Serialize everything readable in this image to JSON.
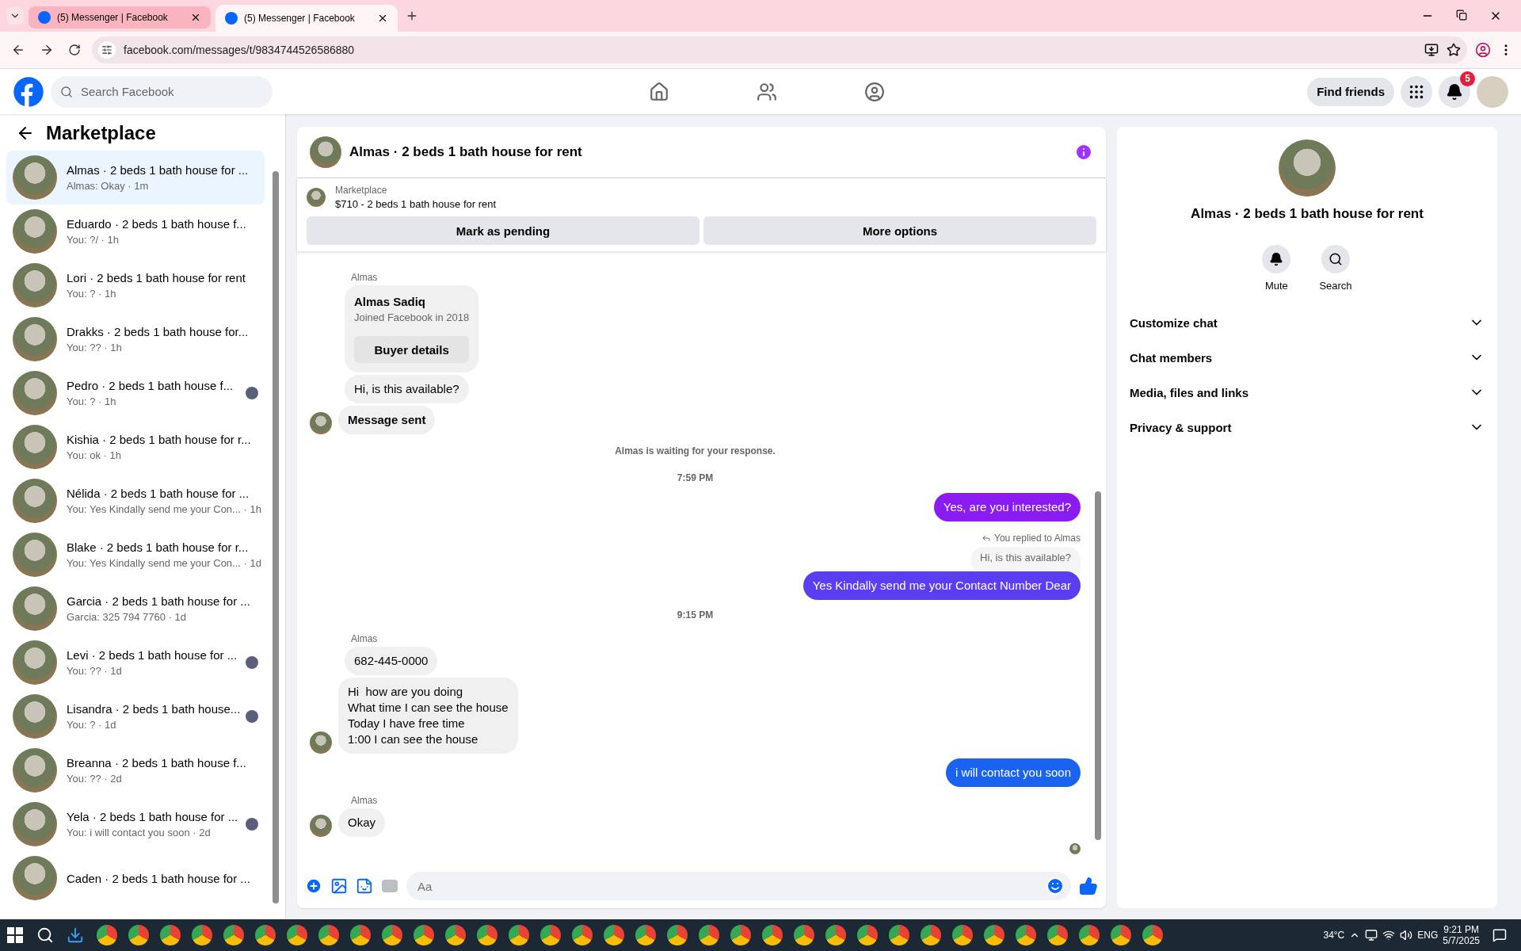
{
  "browser": {
    "tabs": [
      {
        "title": "(5) Messenger | Facebook",
        "selected": false
      },
      {
        "title": "(5) Messenger | Facebook",
        "selected": true
      }
    ],
    "url": "facebook.com/messages/t/9834744526586880"
  },
  "header": {
    "search_placeholder": "Search Facebook",
    "nav": [
      {
        "kind": "home"
      },
      {
        "kind": "friends"
      },
      {
        "kind": "groups"
      }
    ],
    "find_friends": "Find friends",
    "notifications_badge": "5"
  },
  "sidebar": {
    "title": "Marketplace",
    "items": [
      {
        "name": "Almas · 2 beds 1 bath house for ...",
        "preview": "Almas: Okay · 1m",
        "selected": true,
        "seen": false
      },
      {
        "name": "Eduardo · 2 beds 1 bath house f...",
        "preview": "You: ?/ · 1h",
        "selected": false,
        "seen": false
      },
      {
        "name": "Lori · 2 beds 1 bath house for rent",
        "preview": "You: ? · 1h",
        "selected": false,
        "seen": false
      },
      {
        "name": "Drakks · 2 beds 1 bath house for...",
        "preview": "You: ?? · 1h",
        "selected": false,
        "seen": false
      },
      {
        "name": "Pedro · 2 beds 1 bath house f...",
        "preview": "You: ? · 1h",
        "selected": false,
        "seen": true
      },
      {
        "name": "Kishia · 2 beds 1 bath house for r...",
        "preview": "You: ok · 1h",
        "selected": false,
        "seen": false
      },
      {
        "name": "Nélida · 2 beds 1 bath house for ...",
        "preview": "You: Yes Kindally send me your Con... · 1h",
        "selected": false,
        "seen": false
      },
      {
        "name": "Blake · 2 beds 1 bath house for r...",
        "preview": "You: Yes Kindally send me your Con... · 1d",
        "selected": false,
        "seen": false
      },
      {
        "name": "Garcia · 2 beds 1 bath house for ...",
        "preview": "Garcia: 325 794 7760 · 1d",
        "selected": false,
        "seen": false
      },
      {
        "name": "Levi · 2 beds 1 bath house for ...",
        "preview": "You: ?? · 1d",
        "selected": false,
        "seen": true
      },
      {
        "name": "Lisandra · 2 beds 1 bath house...",
        "preview": "You: ? · 1d",
        "selected": false,
        "seen": true
      },
      {
        "name": "Breanna · 2 beds 1 bath house f...",
        "preview": "You: ?? · 2d",
        "selected": false,
        "seen": false
      },
      {
        "name": "Yela · 2 beds 1 bath house for ...",
        "preview": "You: i will contact you soon · 2d",
        "selected": false,
        "seen": true
      },
      {
        "name": "Caden · 2 beds 1 bath house for ...",
        "selected": false,
        "seen": false
      }
    ]
  },
  "chat": {
    "title": "Almas · 2 beds 1 bath house for rent",
    "listing_label": "Marketplace",
    "listing_title": "$710 - 2 beds 1 bath house for rent",
    "actions": [
      "Mark as pending",
      "More options"
    ],
    "messages": [
      {
        "kind": "sender",
        "text": "Almas"
      },
      {
        "kind": "profile_card",
        "name": "Almas Sadiq",
        "sub": "Joined Facebook in 2018",
        "button": "Buyer details"
      },
      {
        "kind": "incoming",
        "text": "Hi, is this available?",
        "avatar": false,
        "emphasis": false
      },
      {
        "kind": "incoming",
        "text": "Message sent",
        "avatar": true,
        "emphasis": true
      },
      {
        "kind": "notice",
        "text": "Almas is waiting for your response."
      },
      {
        "kind": "time",
        "text": "7:59 PM"
      },
      {
        "kind": "outgoing",
        "text": "Yes, are you interested?",
        "color": "#8a1cf2"
      },
      {
        "kind": "reply_label",
        "text": "You replied to Almas"
      },
      {
        "kind": "quoted",
        "text": "Hi, is this available?"
      },
      {
        "kind": "outgoing",
        "text": "Yes Kindally send me your Contact Number Dear",
        "color": "#5b3df2"
      },
      {
        "kind": "time",
        "text": "9:15 PM"
      },
      {
        "kind": "sender",
        "text": "Almas"
      },
      {
        "kind": "incoming",
        "text": "682-445-0000",
        "avatar": false,
        "emphasis": false
      },
      {
        "kind": "incoming",
        "text": "Hi  how are you doing\nWhat time I can see the house\nToday I have free time\n1:00 I can see the house",
        "avatar": true,
        "emphasis": false
      },
      {
        "kind": "outgoing",
        "text": "i will contact you soon",
        "color": "#1a63f0"
      },
      {
        "kind": "sender",
        "text": "Almas"
      },
      {
        "kind": "incoming",
        "text": "Okay",
        "avatar": true,
        "emphasis": false
      }
    ],
    "composer_placeholder": "Aa"
  },
  "details": {
    "title": "Almas · 2 beds 1 bath house for rent",
    "actions": [
      {
        "kind": "mute",
        "label": "Mute"
      },
      {
        "kind": "search",
        "label": "Search"
      }
    ],
    "sections": [
      {
        "label": "Customize chat",
        "expanded": false
      },
      {
        "label": "Chat members",
        "expanded": false
      },
      {
        "label": "Media, files and links",
        "expanded": false
      },
      {
        "label": "Privacy & support",
        "expanded": false
      }
    ]
  },
  "taskbar": {
    "temperature": "34°C",
    "language": "ENG",
    "time": "9:21 PM",
    "date": "5/7/2025"
  }
}
